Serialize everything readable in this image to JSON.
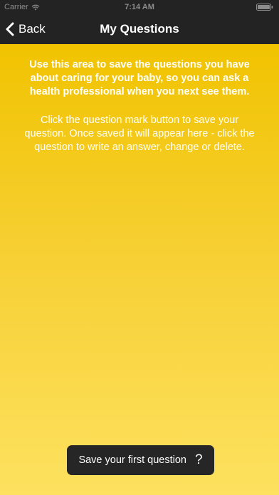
{
  "status_bar": {
    "carrier": "Carrier",
    "time": "7:14 AM",
    "wifi_icon": "wifi-icon",
    "battery_icon": "battery-icon"
  },
  "nav": {
    "back_label": "Back",
    "back_icon": "chevron-left-icon",
    "title": "My Questions"
  },
  "content": {
    "intro": "Use this area to save the questions you have about caring for your baby, so you can ask a health professional when you next see them.",
    "instructions": "Click the question mark button to save your question. Once saved it will appear here - click the question to write an answer, change or delete."
  },
  "save_button": {
    "label": "Save your first question",
    "icon_glyph": "?",
    "icon": "question-mark-icon"
  },
  "colors": {
    "bar_background": "#232323",
    "gradient_top": "#f1c300",
    "gradient_bottom": "#fde15f",
    "button_background": "#262626"
  }
}
